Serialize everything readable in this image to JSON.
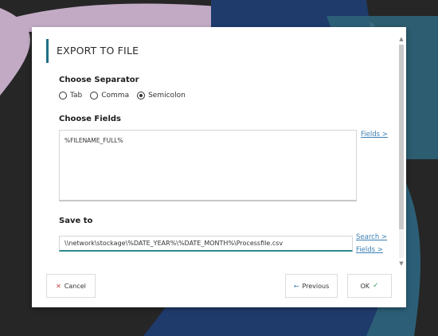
{
  "dialog": {
    "title": "EXPORT TO FILE",
    "separator": {
      "label": "Choose Separator",
      "options": [
        "Tab",
        "Comma",
        "Semicolon"
      ],
      "selected": "Semicolon"
    },
    "fields": {
      "label": "Choose Fields",
      "value": "%FILENAME_FULL%",
      "link": "Fields >"
    },
    "save_to": {
      "label": "Save to",
      "value": "\\\\network\\stockage\\%DATE_YEAR%\\%DATE_MONTH%\\Processfile.csv",
      "search_link": "Search >",
      "fields_link": "Fields >"
    },
    "buttons": {
      "cancel": "Cancel",
      "previous": "Previous",
      "ok": "OK"
    }
  },
  "icons": {
    "cancel": "close-icon",
    "previous": "arrow-left-icon",
    "ok": "check-icon"
  },
  "colors": {
    "accent": "#1f6f86",
    "link": "#3a7fb4",
    "ok_check": "#3a9a5c",
    "cancel_x": "#d33c3c"
  }
}
